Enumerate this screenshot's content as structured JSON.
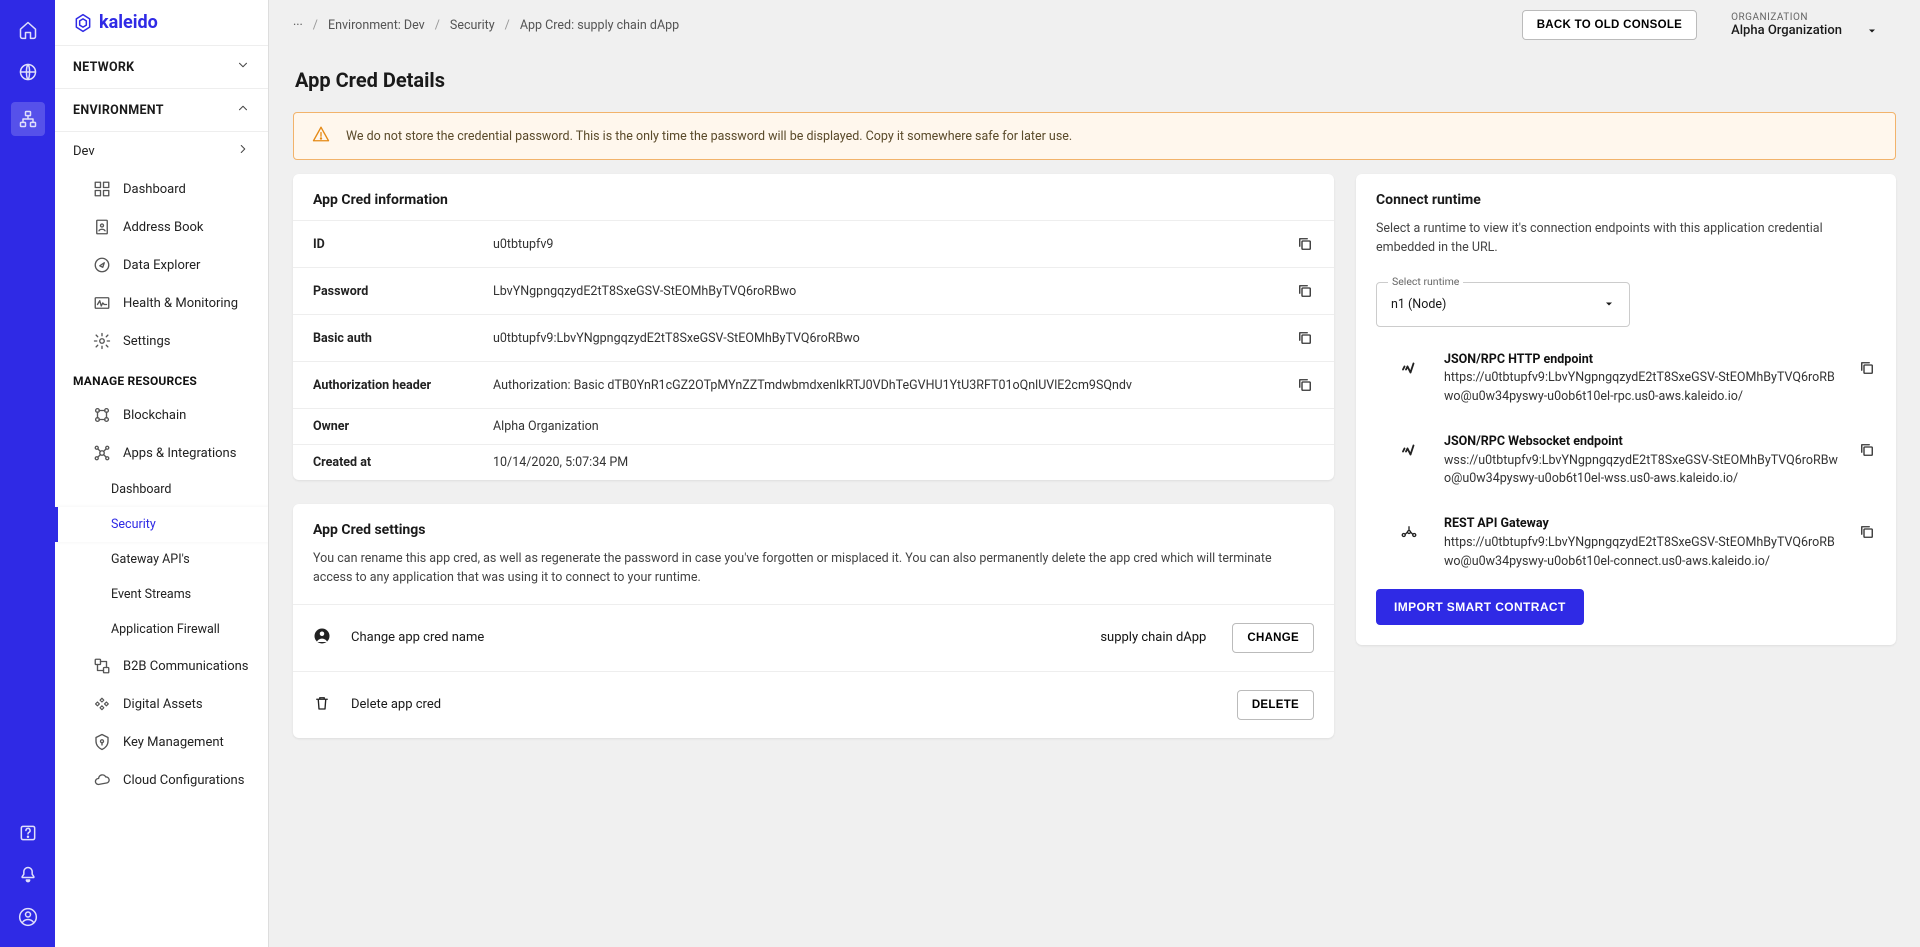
{
  "brand": "kaleido",
  "rail": {
    "items": [
      "home",
      "globe",
      "sitemap"
    ],
    "active_index": 2,
    "bottom": [
      "help",
      "notifications",
      "account"
    ]
  },
  "sidebar": {
    "network_header": "NETWORK",
    "environment_header": "ENVIRONMENT",
    "env_name": "Dev",
    "env_items": [
      {
        "icon": "dashboard",
        "label": "Dashboard"
      },
      {
        "icon": "address-book",
        "label": "Address Book"
      },
      {
        "icon": "compass",
        "label": "Data Explorer"
      },
      {
        "icon": "health",
        "label": "Health & Monitoring"
      },
      {
        "icon": "gear",
        "label": "Settings"
      }
    ],
    "manage_label": "MANAGE RESOURCES",
    "manage_items": [
      {
        "icon": "blockchain",
        "label": "Blockchain"
      },
      {
        "icon": "apps",
        "label": "Apps & Integrations",
        "children": [
          {
            "label": "Dashboard"
          },
          {
            "label": "Security",
            "selected": true
          },
          {
            "label": "Gateway API's"
          },
          {
            "label": "Event Streams"
          },
          {
            "label": "Application Firewall"
          }
        ]
      },
      {
        "icon": "b2b",
        "label": "B2B Communications"
      },
      {
        "icon": "assets",
        "label": "Digital Assets"
      },
      {
        "icon": "key",
        "label": "Key Management"
      },
      {
        "icon": "cloud",
        "label": "Cloud Configurations"
      }
    ]
  },
  "breadcrumb": {
    "items": [
      "···",
      "Environment: Dev",
      "Security",
      "App Cred: supply chain dApp"
    ]
  },
  "header": {
    "back_button": "BACK TO OLD CONSOLE",
    "org_label": "ORGANIZATION",
    "org_name": "Alpha Organization"
  },
  "page": {
    "title": "App Cred Details",
    "alert": "We do not store the credential password. This is the only time the password will be displayed. Copy it somewhere safe for later use."
  },
  "info_card": {
    "title": "App Cred information",
    "rows": [
      {
        "key": "ID",
        "value": "u0tbtupfv9",
        "copy": true
      },
      {
        "key": "Password",
        "value": "LbvYNgpngqzydE2tT8SxeGSV-StEOMhByTVQ6roRBwo",
        "copy": true
      },
      {
        "key": "Basic auth",
        "value": "u0tbtupfv9:LbvYNgpngqzydE2tT8SxeGSV-StEOMhByTVQ6roRBwo",
        "copy": true
      },
      {
        "key": "Authorization header",
        "value": "Authorization: Basic dTB0YnR1cGZ2OTpMYnZZTmdwbmdxenlkRTJ0VDhTeGVHU1YtU3RFT01oQnlUVlE2cm9SQndv",
        "copy": true
      },
      {
        "key": "Owner",
        "value": "Alpha Organization",
        "copy": false
      },
      {
        "key": "Created at",
        "value": "10/14/2020, 5:07:34 PM",
        "copy": false
      }
    ]
  },
  "settings_card": {
    "title": "App Cred settings",
    "description": "You can rename this app cred, as well as regenerate the password in case you've forgotten or misplaced it. You can also permanently delete the app cred which will terminate access to any application that was using it to connect to your runtime.",
    "rows": [
      {
        "icon": "person",
        "label": "Change app cred name",
        "current": "supply chain dApp",
        "action": "CHANGE"
      },
      {
        "icon": "trash",
        "label": "Delete app cred",
        "current": "",
        "action": "DELETE"
      }
    ]
  },
  "runtime_card": {
    "title": "Connect runtime",
    "description": "Select a runtime to view it's connection endpoints with this application credential embedded in the URL.",
    "select_label": "Select runtime",
    "selected": "n1 (Node)",
    "endpoints": [
      {
        "icon": "http",
        "title": "JSON/RPC HTTP endpoint",
        "url": "https://u0tbtupfv9:LbvYNgpngqzydE2tT8SxeGSV-StEOMhByTVQ6roRBwo@u0w34pyswy-u0ob6t10el-rpc.us0-aws.kaleido.io/"
      },
      {
        "icon": "ws",
        "title": "JSON/RPC Websocket endpoint",
        "url": "wss://u0tbtupfv9:LbvYNgpngqzydE2tT8SxeGSV-StEOMhByTVQ6roRBwo@u0w34pyswy-u0ob6t10el-wss.us0-aws.kaleido.io/"
      },
      {
        "icon": "rest",
        "title": "REST API Gateway",
        "url": "https://u0tbtupfv9:LbvYNgpngqzydE2tT8SxeGSV-StEOMhByTVQ6roRBwo@u0w34pyswy-u0ob6t10el-connect.us0-aws.kaleido.io/"
      }
    ],
    "import_button": "IMPORT SMART CONTRACT"
  }
}
